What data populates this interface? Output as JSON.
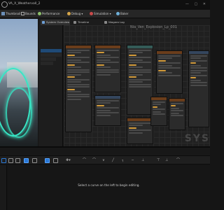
{
  "window": {
    "title": "VA_X_WeathervalI_2",
    "controls": "— ▢ ✕"
  },
  "toolbar": {
    "items": [
      {
        "label": "Thumbnail",
        "icon": "image-icon"
      },
      {
        "label": "Bounds",
        "icon": "bounds-icon"
      },
      {
        "label": "Performance",
        "icon": "performance-icon"
      },
      {
        "label": "Debug",
        "icon": "debug-icon"
      },
      {
        "label": "Simulation",
        "icon": "simulation-icon"
      },
      {
        "label": "Baker",
        "icon": "baker-icon"
      }
    ]
  },
  "tabs": {
    "system_overview": "System Overview",
    "timeline": "Timeline",
    "niagara_log": "Niagara Log"
  },
  "graph": {
    "title": "Nia_Ven_Explosion_Lp_001",
    "watermark": "SYS"
  },
  "curve_editor": {
    "message": "Select a curve on the left to begin editing."
  },
  "colors": {
    "accent": "#2a78d6",
    "emitter_header": "#6a3d1b",
    "effect": "#37e6c5"
  }
}
